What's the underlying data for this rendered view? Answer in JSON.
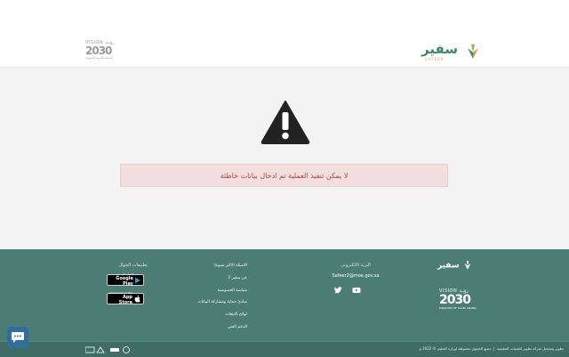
{
  "header": {
    "logo_text": "سفير",
    "logo_sub": "SAFEER",
    "vision_top": {
      "line1": "VISION رؤيـة",
      "line2": "2030",
      "line3": "المملكة العربية السعودية"
    }
  },
  "error": {
    "icon": "warning-triangle-icon",
    "message": "لا يمكن تنفيذ العملية تم ادخال بيانات خاطئة"
  },
  "footer": {
    "logo_text": "سفير",
    "vision": {
      "line1": "VISION رؤيـة",
      "line2": "2030",
      "line3": "KINGDOM OF SAUDI ARABIA"
    },
    "email_title": "البريد الالكتروني",
    "email": "Safeer2@moe.gov.sa",
    "social": [
      "twitter-icon",
      "youtube-icon"
    ],
    "links": [
      "الاسئلة الاكثر شيوعا",
      "عن سفير 2",
      "سياسة الخصوصية",
      "مبادئ حماية ومشاركة البيانات",
      "لوائح الابتعاث",
      "الدعم الفني"
    ],
    "apps_title": "تطبيقات الجوال",
    "google_play": {
      "small": "احصل عليه من",
      "big": "Google Play"
    },
    "app_store": {
      "small": "Download on the",
      "big": "App Store"
    },
    "copyright": "جميع الحقوق محفوظة لوزارة التعليم © 2022 م",
    "developer": "تطوير وتشغيل شركة تطوير للتقنيات التعليمية"
  },
  "colors": {
    "footer": "#4b7d74",
    "alert_bg": "#f2dede",
    "alert_text": "#a94442",
    "chat": "#2f6e9d"
  }
}
